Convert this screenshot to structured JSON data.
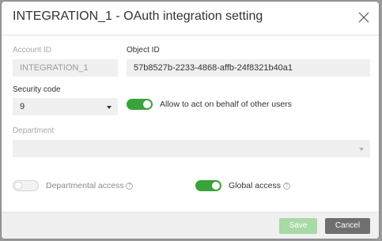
{
  "dialog": {
    "title": "INTEGRATION_1 - OAuth integration setting"
  },
  "form": {
    "account_id": {
      "label": "Account ID",
      "value": "INTEGRATION_1"
    },
    "object_id": {
      "label": "Object ID",
      "value": "57b8527b-2233-4868-affb-24f8321b40a1"
    },
    "security_code": {
      "label": "Security code",
      "value": "9"
    },
    "act_on_behalf": {
      "label": "Allow to act on behalf of other users",
      "checked": true
    },
    "department": {
      "label": "Department",
      "value": ""
    },
    "departmental_access": {
      "label": "Departmental access",
      "checked": false
    },
    "global_access": {
      "label": "Global access",
      "checked": true
    }
  },
  "footer": {
    "save_label": "Save",
    "cancel_label": "Cancel"
  },
  "colors": {
    "toggle_on": "#3aa33a",
    "save_disabled": "#a8d9a8",
    "cancel": "#6f6f6f"
  },
  "icons": [
    "close-icon",
    "chevron-down-icon",
    "help-icon"
  ]
}
